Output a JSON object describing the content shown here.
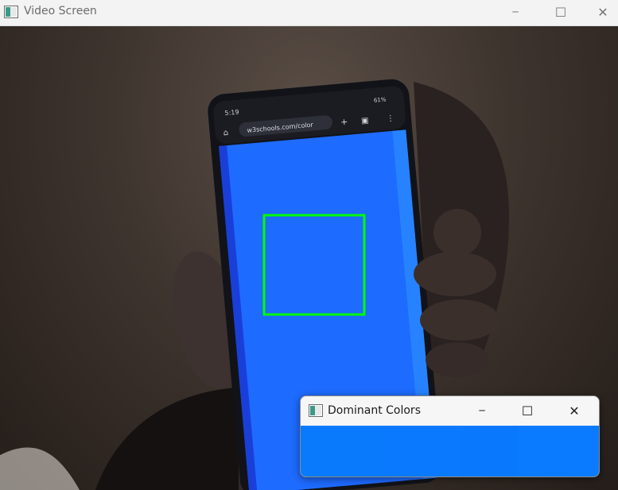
{
  "main_window": {
    "title": "Video Screen",
    "controls": {
      "minimize": "─",
      "maximize": "☐",
      "close": "✕"
    }
  },
  "phone": {
    "status_time": "5:19",
    "status_right": "61%",
    "url": "w3schools.com/color",
    "screen_color": "#1e6bff",
    "detection_box_color": "#00ff00"
  },
  "popup_window": {
    "title": "Dominant Colors",
    "controls": {
      "minimize": "─",
      "maximize": "☐",
      "close": "✕"
    },
    "swatches": [
      "#0a7afd",
      "#0b79fe",
      "#0a78fc",
      "#0a7aff"
    ]
  }
}
